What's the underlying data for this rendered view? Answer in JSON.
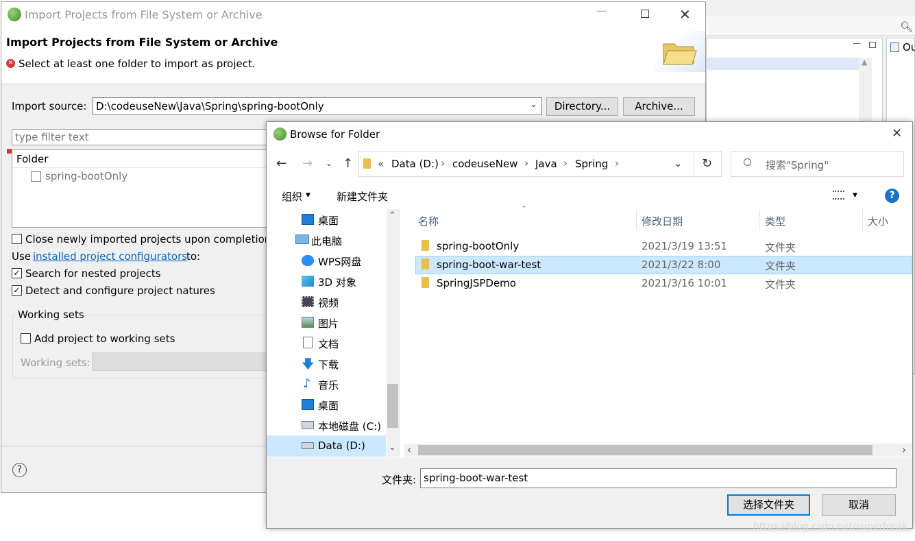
{
  "background": {
    "outline_tab": "Ou"
  },
  "import_dialog": {
    "window_title": "Import Projects from File System or Archive",
    "header_title": "Import Projects from File System or Archive",
    "error_message": "Select at least one folder to import as project.",
    "import_source_label": "Import source:",
    "import_source_value": "D:\\codeuseNew\\Java\\Spring\\spring-bootOnly",
    "directory_button": "Directory...",
    "archive_button": "Archive...",
    "filter_placeholder": "type filter text",
    "folder_column": "Folder",
    "folder_item": "spring-bootOnly",
    "close_newly": "Close newly imported projects upon completion",
    "use_prefix": "Use",
    "use_link": "installed project configurators",
    "use_suffix": "to:",
    "search_nested": "Search for nested projects",
    "detect_configure": "Detect and configure project natures",
    "working_sets_group": "Working sets",
    "add_to_working_sets": "Add project to working sets",
    "working_sets_label": "Working sets:"
  },
  "browse_dialog": {
    "title": "Browse for Folder",
    "breadcrumb": [
      "Data (D:)",
      "codeuseNew",
      "Java",
      "Spring"
    ],
    "breadcrumb_overflow": "«",
    "search_placeholder": "搜索\"Spring\"",
    "organize": "组织",
    "new_folder": "新建文件夹",
    "nav_items": [
      {
        "label": "桌面",
        "icon": "desktop-icon"
      },
      {
        "label": "此电脑",
        "icon": "computer-icon"
      },
      {
        "label": "WPS网盘",
        "icon": "cloud-icon"
      },
      {
        "label": "3D 对象",
        "icon": "3d-objects-icon"
      },
      {
        "label": "视频",
        "icon": "video-icon"
      },
      {
        "label": "图片",
        "icon": "pictures-icon"
      },
      {
        "label": "文档",
        "icon": "documents-icon"
      },
      {
        "label": "下载",
        "icon": "download-icon"
      },
      {
        "label": "音乐",
        "icon": "music-icon"
      },
      {
        "label": "桌面",
        "icon": "desktop-icon"
      },
      {
        "label": "本地磁盘 (C:)",
        "icon": "drive-icon"
      },
      {
        "label": "Data (D:)",
        "icon": "drive-icon"
      }
    ],
    "columns": {
      "name": "名称",
      "date": "修改日期",
      "type": "类型",
      "size": "大小"
    },
    "files": [
      {
        "name": "spring-bootOnly",
        "date": "2021/3/19 13:51",
        "type": "文件夹"
      },
      {
        "name": "spring-boot-war-test",
        "date": "2021/3/22 8:00",
        "type": "文件夹"
      },
      {
        "name": "SpringJSPDemo",
        "date": "2021/3/16 10:01",
        "type": "文件夹"
      }
    ],
    "folder_label": "文件夹:",
    "folder_value": "spring-boot-war-test",
    "select_button": "选择文件夹",
    "cancel_button": "取消"
  },
  "watermark": "https://blog.csdn.net/superfreak"
}
